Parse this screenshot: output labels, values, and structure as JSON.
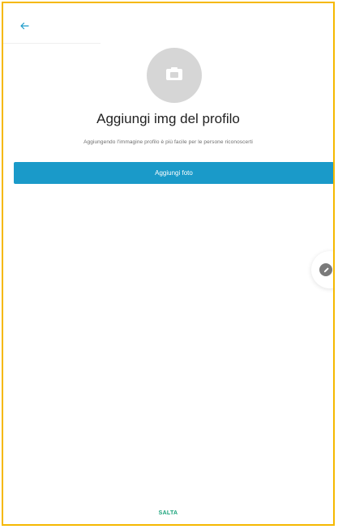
{
  "header": {
    "back_icon": "arrow-left-icon"
  },
  "avatar": {
    "icon": "camera-icon"
  },
  "content": {
    "title": "Aggiungi img del profilo",
    "subtitle": "Aggiungendo l'immagine profilo è più facile per le persone riconoscerti"
  },
  "actions": {
    "add_photo_label": "Aggiungi foto",
    "skip_label": "SALTA"
  },
  "fab": {
    "icon": "pencil-icon"
  },
  "colors": {
    "accent": "#1a9ac9",
    "skip": "#19a37a",
    "frame_border": "#f5b800",
    "avatar_bg": "#d6d6d6"
  }
}
